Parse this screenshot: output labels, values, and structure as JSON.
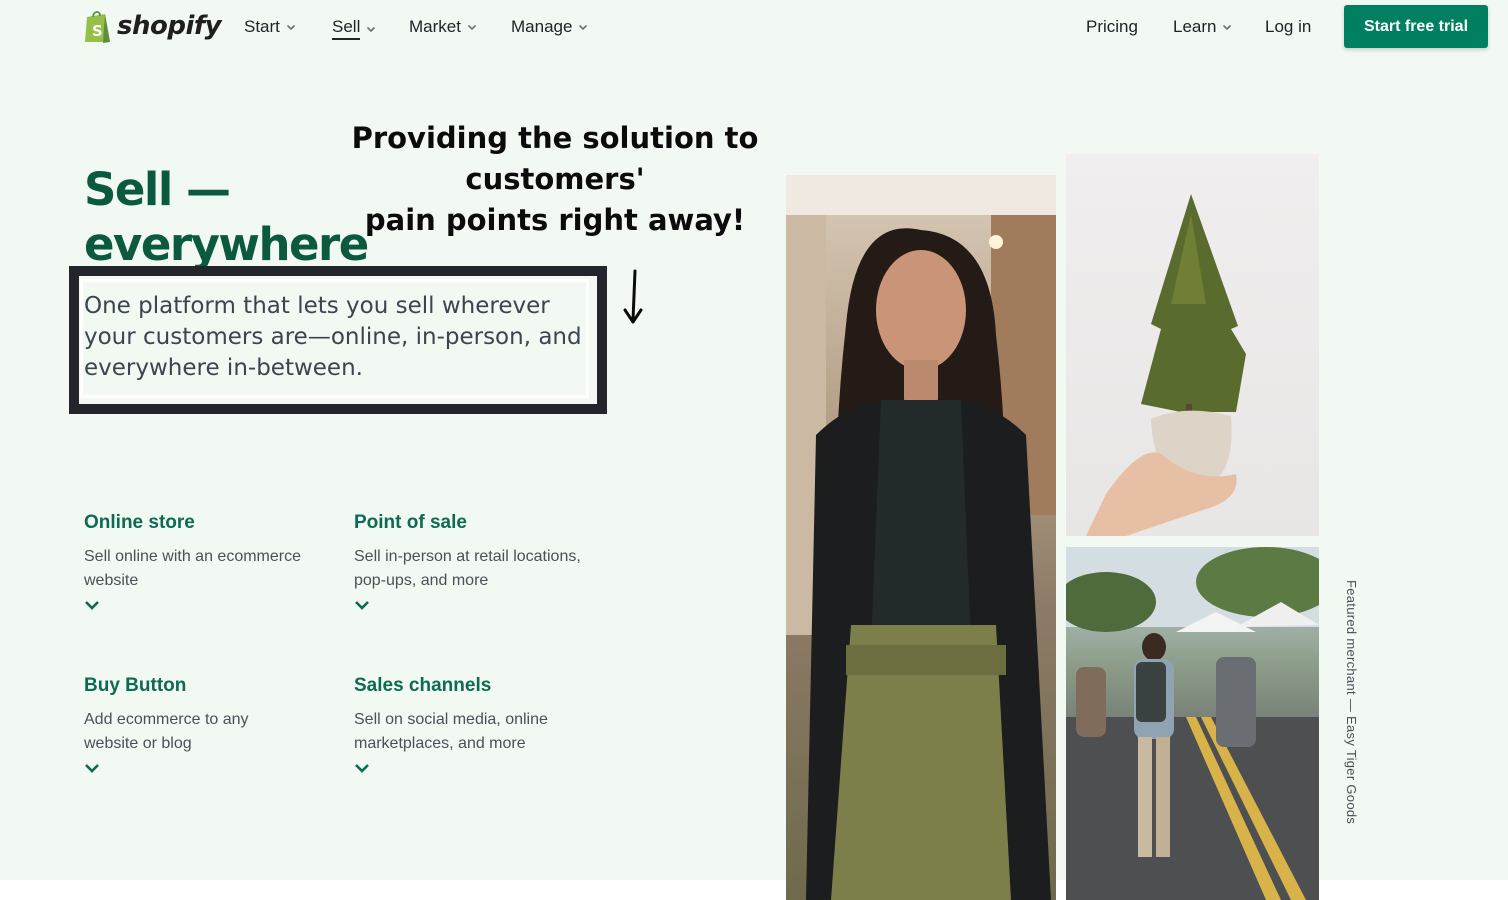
{
  "nav": {
    "logo_text": "shopify",
    "items": [
      {
        "label": "Start"
      },
      {
        "label": "Sell"
      },
      {
        "label": "Market"
      },
      {
        "label": "Manage"
      }
    ],
    "right": {
      "pricing": "Pricing",
      "learn": "Learn",
      "login": "Log in",
      "cta": "Start free trial"
    }
  },
  "annotation": {
    "line1": "Providing the solution to customers'",
    "line2": "pain points right away!"
  },
  "hero": {
    "title_line1": "Sell —",
    "title_line2": "everywhere",
    "subtitle": "One platform that lets you sell wherever your customers are—online, in-person, and everywhere in-between."
  },
  "features": [
    {
      "title": "Online store",
      "desc": "Sell online with an ecommerce website"
    },
    {
      "title": "Point of sale",
      "desc": "Sell in-person at retail locations, pop-ups, and more"
    },
    {
      "title": "Buy Button",
      "desc": "Add ecommerce to any website or blog"
    },
    {
      "title": "Sales channels",
      "desc": "Sell on social media, online marketplaces, and more"
    }
  ],
  "caption": "Featured merchant — Easy Tiger Goods",
  "colors": {
    "page_background": "#f2f9f3",
    "brand_green": "#008060",
    "heading_green": "#0b5a3f",
    "feature_green": "#0c6b52"
  },
  "icons": [
    "shopify-bag-icon",
    "chevron-down-icon",
    "arrow-down-icon"
  ]
}
